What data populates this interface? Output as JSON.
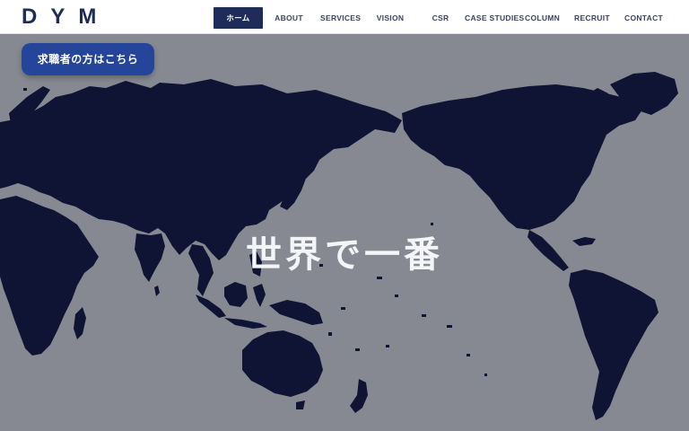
{
  "brand": {
    "logo": "DYM"
  },
  "nav": {
    "items": [
      {
        "label": "ホーム",
        "active": true
      },
      {
        "label": "ABOUT"
      },
      {
        "label": "SERVICES"
      },
      {
        "label": "VISION"
      },
      {
        "label": "CSR"
      },
      {
        "label": "CASE STUDIES"
      },
      {
        "label": "COLUMN"
      },
      {
        "label": "RECRUIT"
      },
      {
        "label": "CONTACT"
      }
    ]
  },
  "hero": {
    "cta_label": "求職者の方はこちら",
    "heading": "世界で一番"
  },
  "colors": {
    "brand_navy": "#1f2b58",
    "cta_blue": "#24459a",
    "map_land": "#0f1434",
    "map_ocean": "#868991"
  }
}
